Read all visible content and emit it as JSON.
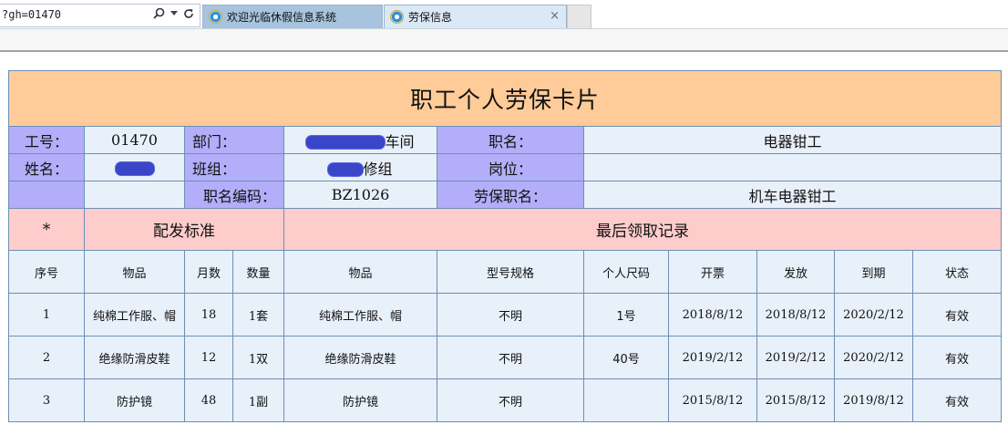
{
  "browser": {
    "address_text": "?gh=01470",
    "tabs": [
      {
        "label": "欢迎光临休假信息系统"
      },
      {
        "label": "劳保信息"
      }
    ],
    "close_glyph": "×"
  },
  "card": {
    "title": "职工个人劳保卡片",
    "info": {
      "gonghao_label": "工号：",
      "gonghao_value": "01470",
      "bumen_label": "部门：",
      "bumen_value_visible": "车间",
      "zhiming_label": "职名：",
      "zhiming_value": "电器钳工",
      "xingming_label": "姓名：",
      "banzu_label": "班组：",
      "banzu_value_visible": "修组",
      "gangwei_label": "岗位：",
      "gangwei_value": "",
      "zhiming_code_label": "职名编码：",
      "zhiming_code_value": "BZ1026",
      "laobao_zhiming_label": "劳保职名：",
      "laobao_zhiming_value": "机车电器钳工"
    },
    "sections": {
      "star": "*",
      "standard": "配发标准",
      "last_record": "最后领取记录"
    },
    "columns": [
      "序号",
      "物品",
      "月数",
      "数量",
      "物品",
      "型号规格",
      "个人尺码",
      "开票",
      "发放",
      "到期",
      "状态"
    ],
    "rows": [
      [
        "1",
        "纯棉工作服、帽",
        "18",
        "1套",
        "纯棉工作服、帽",
        "不明",
        "1号",
        "2018/8/12",
        "2018/8/12",
        "2020/2/12",
        "有效"
      ],
      [
        "2",
        "绝缘防滑皮鞋",
        "12",
        "1双",
        "绝缘防滑皮鞋",
        "不明",
        "40号",
        "2019/2/12",
        "2019/2/12",
        "2020/2/12",
        "有效"
      ],
      [
        "3",
        "防护镜",
        "48",
        "1副",
        "防护镜",
        "不明",
        "",
        "2015/8/12",
        "2015/8/12",
        "2019/8/12",
        "有效"
      ]
    ]
  }
}
